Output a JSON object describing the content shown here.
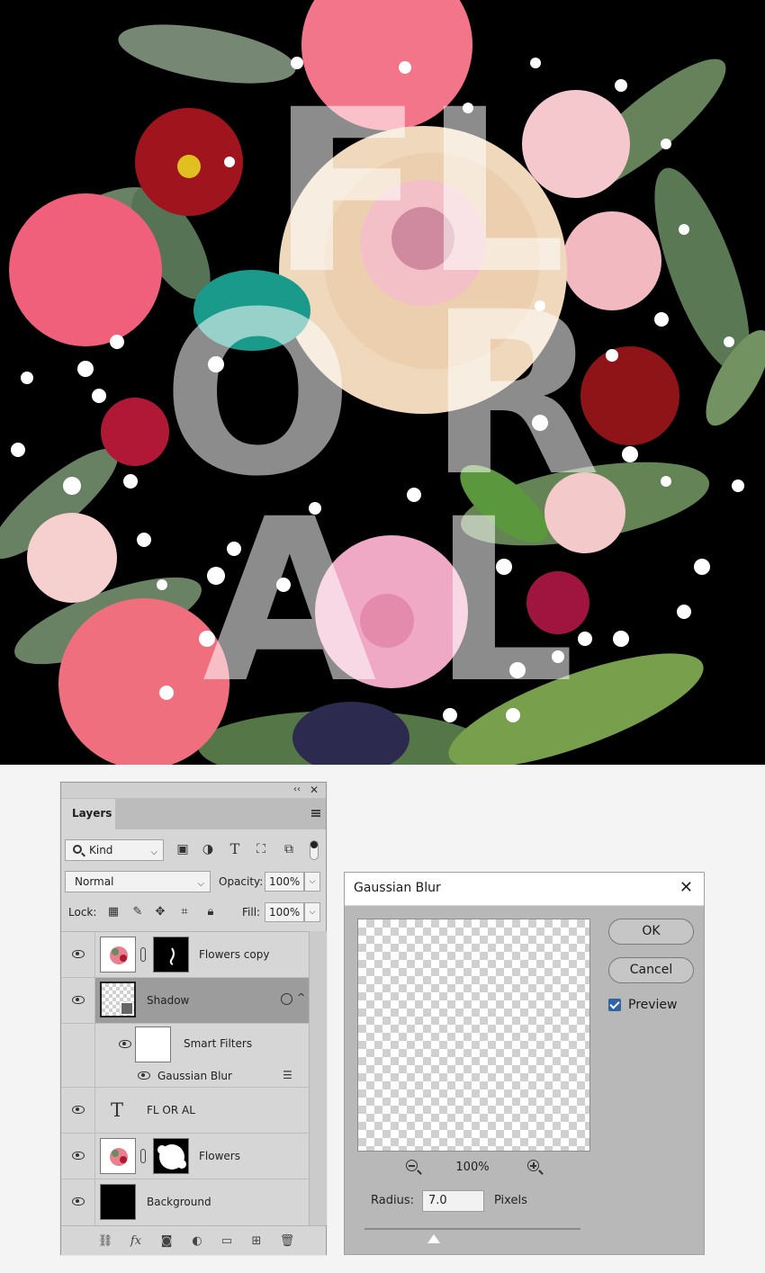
{
  "artwork": {
    "poster_text": "FL OR AL",
    "letters": [
      "F",
      "L",
      "O",
      "R",
      "A",
      "L"
    ]
  },
  "layers_panel": {
    "tab_label": "Layers",
    "collapse_glyph": "‹‹",
    "close_glyph": "✕",
    "filter_kind": "Kind",
    "blend_mode": "Normal",
    "opacity_label": "Opacity:",
    "opacity_value": "100%",
    "lock_label": "Lock:",
    "fill_label": "Fill:",
    "fill_value": "100%",
    "layers": [
      {
        "name": "Flowers copy",
        "type": "masked-image"
      },
      {
        "name": "Shadow",
        "type": "smart-object",
        "selected": true
      },
      {
        "name": "Smart Filters",
        "type": "smart-filters"
      },
      {
        "name": "Gaussian Blur",
        "type": "filter"
      },
      {
        "name": "FL OR AL",
        "type": "text"
      },
      {
        "name": "Flowers",
        "type": "masked-image"
      },
      {
        "name": "Background",
        "type": "fill"
      }
    ],
    "text_layer_glyph": "T"
  },
  "dialog": {
    "title": "Gaussian Blur",
    "close_glyph": "✕",
    "ok_label": "OK",
    "cancel_label": "Cancel",
    "preview_label": "Preview",
    "preview_checked": true,
    "zoom_value": "100%",
    "radius_label": "Radius:",
    "radius_value": "7.0",
    "radius_unit": "Pixels",
    "accent_color": "#2e63a6"
  }
}
